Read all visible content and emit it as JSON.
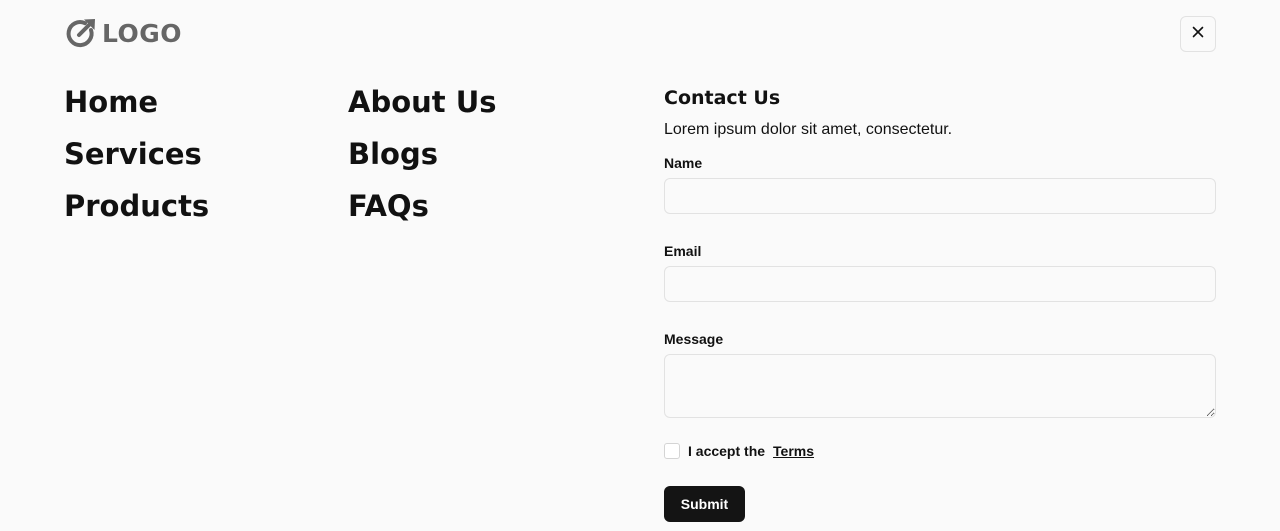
{
  "header": {
    "logo_text": "LOGO",
    "logo_icon": "arrow-circle-icon",
    "close_icon": "close-icon"
  },
  "nav": {
    "column1": [
      "Home",
      "Services",
      "Products"
    ],
    "column2": [
      "About Us",
      "Blogs",
      "FAQs"
    ]
  },
  "contact": {
    "title": "Contact Us",
    "description": "Lorem ipsum dolor sit amet, consectetur.",
    "name_label": "Name",
    "email_label": "Email",
    "message_label": "Message",
    "terms_prefix": "I accept the",
    "terms_link": "Terms",
    "submit_label": "Submit"
  },
  "colors": {
    "background": "#fafafa",
    "text": "#111111",
    "logo": "#666666",
    "button": "#141414",
    "border": "#e2e2e2"
  }
}
